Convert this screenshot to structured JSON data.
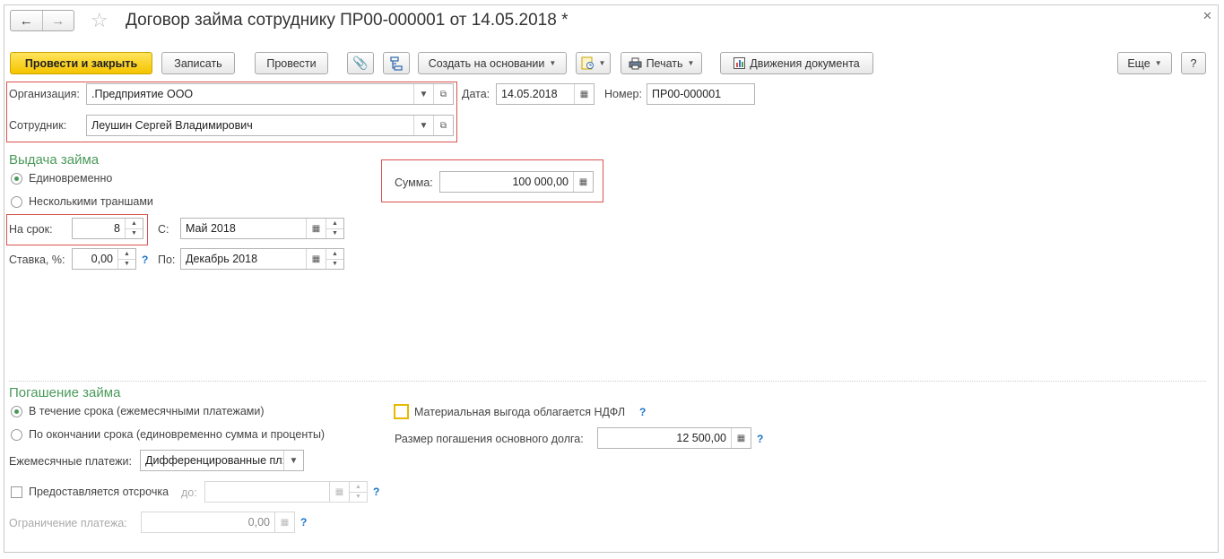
{
  "header": {
    "back_icon": "arrow-left-icon",
    "forward_icon": "arrow-right-icon",
    "favorite_icon": "star-icon",
    "title": "Договор займа сотруднику ПР00-000001 от 14.05.2018 *",
    "close_icon": "close-icon"
  },
  "toolbar": {
    "post_and_close": "Провести и закрыть",
    "save": "Записать",
    "post": "Провести",
    "attach_icon": "paperclip-icon",
    "structure_icon": "structure-icon",
    "create_based_on": "Создать на основании",
    "report_icon": "report-icon",
    "print": "Печать",
    "print_icon": "printer-icon",
    "movements": "Движения документа",
    "movements_icon": "movements-icon",
    "more": "Еще",
    "help": "?"
  },
  "doc": {
    "org_label": "Организация:",
    "org_value": ".Предприятие ООО",
    "employee_label": "Сотрудник:",
    "employee_value": "Леушин Сергей Владимирович",
    "date_label": "Дата:",
    "date_value": "14.05.2018",
    "number_label": "Номер:",
    "number_value": "ПР00-000001"
  },
  "issue": {
    "section_title": "Выдача займа",
    "option_once": "Единовременно",
    "option_tranches": "Несколькими траншами",
    "selected": "once",
    "amount_label": "Сумма:",
    "amount_value": "100 000,00",
    "term_label": "На срок:",
    "term_value": "8",
    "from_label": "С:",
    "from_value": "Май 2018",
    "rate_label": "Ставка, %:",
    "rate_value": "0,00",
    "to_label": "По:",
    "to_value": "Декабрь 2018",
    "help": "?"
  },
  "repay": {
    "section_title": "Погашение займа",
    "option_monthly": "В течение срока (ежемесячными платежами)",
    "option_end": "По окончании срока (единовременно сумма и проценты)",
    "selected": "monthly",
    "monthly_payments_label": "Ежемесячные платежи:",
    "monthly_payments_value": "Дифференцированные пл:",
    "deferral_label": "Предоставляется отсрочка",
    "deferral_until_label": "до:",
    "deferral_until_value": "",
    "limit_label": "Ограничение платежа:",
    "limit_value": "0,00",
    "ndfl_label": "Материальная выгода облагается НДФЛ",
    "principal_label": "Размер погашения основного долга:",
    "principal_value": "12 500,00",
    "help": "?"
  },
  "colors": {
    "accent_green": "#4a9a5a",
    "primary_yellow": "#f5c400",
    "highlight_red": "#d9534f",
    "help_blue": "#1a73c8"
  }
}
